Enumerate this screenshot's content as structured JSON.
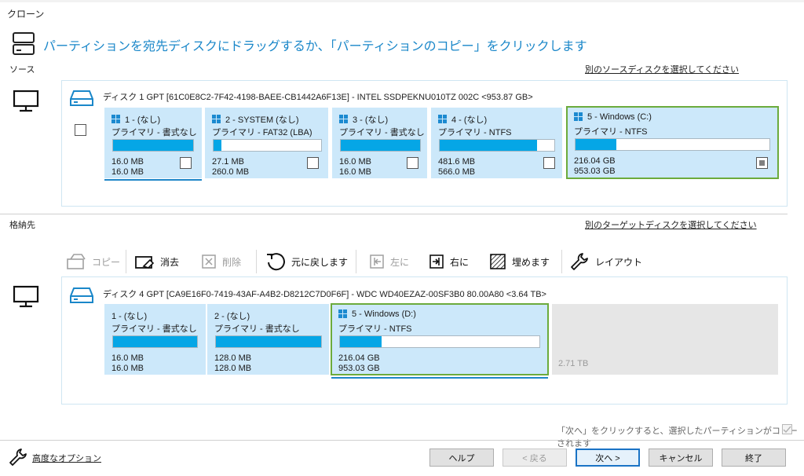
{
  "window_title": "クローン",
  "instruction": "パーティションを宛先ディスクにドラッグするか、「パーティションのコピー」をクリックします",
  "colors": {
    "accent": "#1a87c9",
    "bar_fill": "#05a6e6",
    "partition_bg": "#cce8fa",
    "selected_border": "#6cab3c"
  },
  "source": {
    "label": "ソース",
    "select_link": "別のソースディスクを選択してください",
    "disk_info": "ディスク 1 GPT [61C0E8C2-7F42-4198-BAEE-CB1442A6F13E] - INTEL SSDPEKNU010TZ 002C  <953.87 GB>",
    "partitions": [
      {
        "title": "1 - (なし)",
        "type": "プライマリ - 書式なし",
        "used": "16.0 MB",
        "total": "16.0 MB",
        "fill": 1.0,
        "checked": false,
        "selected": false
      },
      {
        "title": "2 - SYSTEM (なし)",
        "type": "プライマリ - FAT32 (LBA)",
        "used": "27.1 MB",
        "total": "260.0 MB",
        "fill": 0.07,
        "checked": false,
        "selected": false
      },
      {
        "title": "3 - (なし)",
        "type": "プライマリ - 書式なし",
        "used": "16.0 MB",
        "total": "16.0 MB",
        "fill": 1.0,
        "checked": false,
        "selected": false
      },
      {
        "title": "4 - (なし)",
        "type": "プライマリ - NTFS",
        "used": "481.6 MB",
        "total": "566.0 MB",
        "fill": 0.85,
        "checked": false,
        "selected": false
      },
      {
        "title": "5 - Windows (C:)",
        "type": "プライマリ - NTFS",
        "used": "216.04 GB",
        "total": "953.03 GB",
        "fill": 0.23,
        "checked": true,
        "selected": true
      }
    ]
  },
  "target": {
    "label": "格納先",
    "select_link": "別のターゲットディスクを選択してください",
    "disk_info": "ディスク 4 GPT [CA9E16F0-7419-43AF-A4B2-D8212C7D0F6F] - WDC WD40EZAZ-00SF3B0 80.00A80  <3.64 TB>",
    "partitions": [
      {
        "title": "1 - (なし)",
        "type": "プライマリ - 書式なし",
        "used": "16.0 MB",
        "total": "16.0 MB",
        "fill": 1.0,
        "selected": false
      },
      {
        "title": "2 - (なし)",
        "type": "プライマリ - 書式なし",
        "used": "128.0 MB",
        "total": "128.0 MB",
        "fill": 1.0,
        "selected": false
      },
      {
        "title": "5 - Windows (D:)",
        "type": "プライマリ - NTFS",
        "used": "216.04 GB",
        "total": "953.03 GB",
        "fill": 0.2,
        "selected": true
      }
    ],
    "unallocated": "2.71 TB"
  },
  "toolbar": {
    "copy": "コピー",
    "delete": "消去",
    "remove": "削除",
    "undo": "元に戻します",
    "left": "左に",
    "right": "右に",
    "fill": "埋めます",
    "layout": "レイアウト"
  },
  "footer": {
    "hint": "「次へ」をクリックすると、選択したパーティションがコピーされます",
    "advanced": "高度なオプション",
    "help": "ヘルプ",
    "back": "< 戻る",
    "next": "次へ >",
    "cancel": "キャンセル",
    "finish": "終了"
  }
}
